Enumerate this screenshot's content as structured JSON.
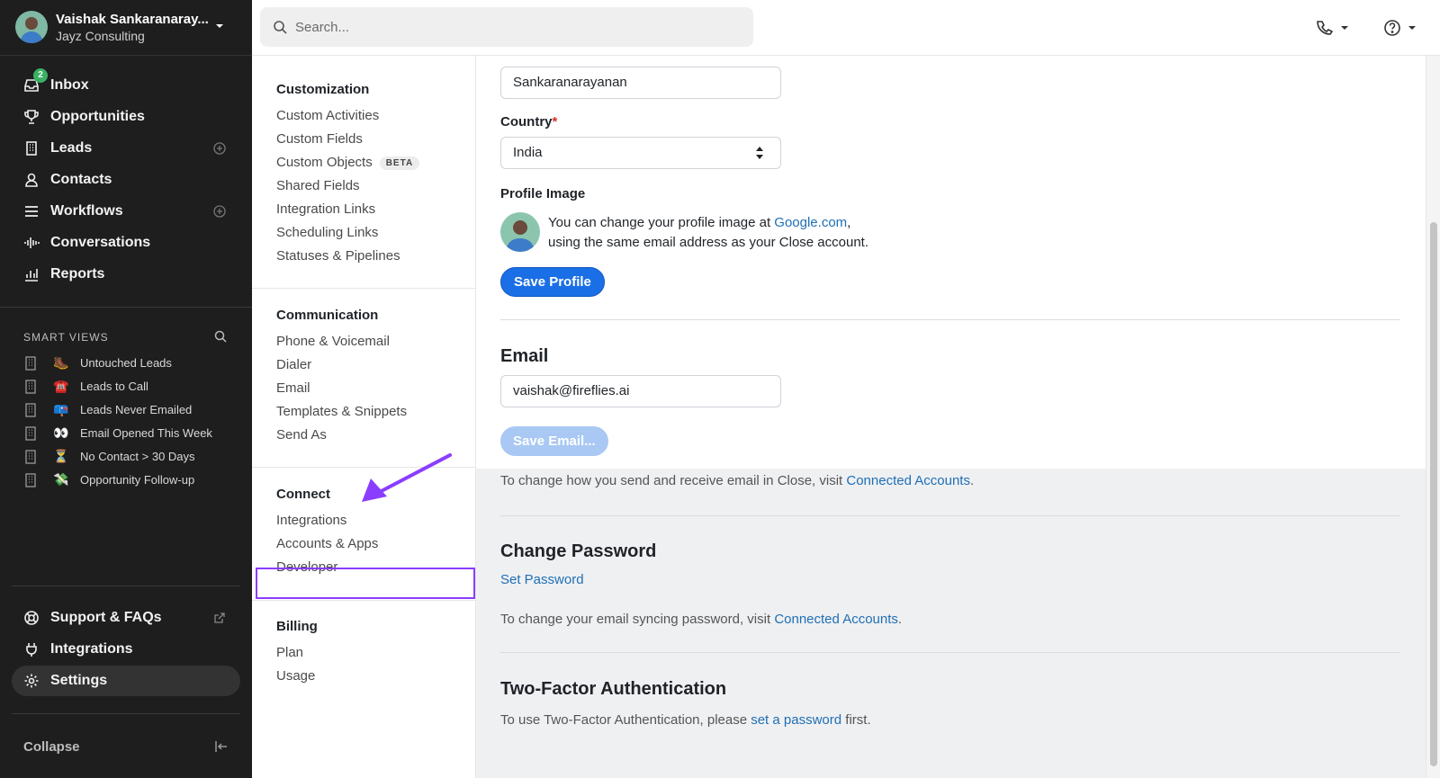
{
  "account": {
    "name": "Vaishak Sankaranaray...",
    "org": "Jayz Consulting"
  },
  "nav": {
    "inbox": {
      "label": "Inbox",
      "badge": "2"
    },
    "opportunities": "Opportunities",
    "leads": "Leads",
    "contacts": "Contacts",
    "workflows": "Workflows",
    "conversations": "Conversations",
    "reports": "Reports"
  },
  "smart_views": {
    "title": "SMART VIEWS",
    "items": [
      {
        "emoji": "🥾",
        "label": "Untouched Leads"
      },
      {
        "emoji": "☎️",
        "label": "Leads to Call"
      },
      {
        "emoji": "📪",
        "label": "Leads Never Emailed"
      },
      {
        "emoji": "👀",
        "label": "Email Opened This Week"
      },
      {
        "emoji": "⏳",
        "label": "No Contact > 30 Days"
      },
      {
        "emoji": "💸",
        "label": "Opportunity Follow-up"
      }
    ]
  },
  "bottom_nav": {
    "support": "Support & FAQs",
    "integrations": "Integrations",
    "settings": "Settings",
    "collapse": "Collapse"
  },
  "search": {
    "placeholder": "Search..."
  },
  "settings_nav": {
    "customization": {
      "title": "Customization",
      "items": [
        "Custom Activities",
        "Custom Fields",
        "Custom Objects",
        "Shared Fields",
        "Integration Links",
        "Scheduling Links",
        "Statuses & Pipelines"
      ],
      "beta": "BETA"
    },
    "communication": {
      "title": "Communication",
      "items": [
        "Phone & Voicemail",
        "Dialer",
        "Email",
        "Templates & Snippets",
        "Send As"
      ]
    },
    "connect": {
      "title": "Connect",
      "items": [
        "Integrations",
        "Accounts & Apps",
        "Developer"
      ]
    },
    "billing": {
      "title": "Billing",
      "items": [
        "Plan",
        "Usage"
      ]
    }
  },
  "profile": {
    "last_name_value": "Sankaranarayanan",
    "country_label": "Country",
    "country_required": "*",
    "country_value": "India",
    "image_label": "Profile Image",
    "image_text_1": "You can change your profile image at ",
    "image_link": "Google.com",
    "image_text_2": ",",
    "image_text_3": "using the same email address as your Close account.",
    "save_button": "Save Profile"
  },
  "email": {
    "title": "Email",
    "value": "vaishak@fireflies.ai",
    "save_button": "Save Email...",
    "note": "To change how you send and receive email in Close, visit ",
    "note_link": "Connected Accounts",
    "note_end": "."
  },
  "password": {
    "title": "Change Password",
    "set_link": "Set Password",
    "note": "To change your email syncing password, visit ",
    "note_link": "Connected Accounts",
    "note_end": "."
  },
  "two_factor": {
    "title": "Two-Factor Authentication",
    "note": "To use Two-Factor Authentication, please ",
    "note_link": "set a password",
    "note_end": " first."
  },
  "colors": {
    "accent": "#1b6fe6",
    "highlight": "#8b3dff",
    "sidebar_bg": "#1e1e1e",
    "badge": "#3ab063"
  }
}
